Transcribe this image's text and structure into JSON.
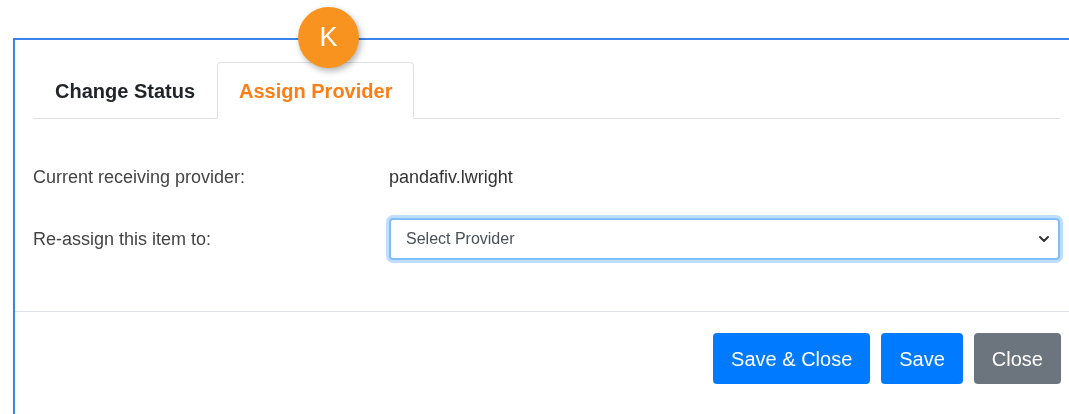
{
  "badge": {
    "label": "K"
  },
  "tabs": [
    {
      "label": "Change Status",
      "selected": false
    },
    {
      "label": "Assign Provider",
      "selected": true
    }
  ],
  "fields": [
    {
      "kind": "text",
      "label": "Current receiving provider:",
      "value": "pandafiv.lwright"
    },
    {
      "kind": "select",
      "label": "Re-assign this item to:",
      "value": "Select Provider"
    }
  ],
  "buttons": [
    {
      "label": "Save & Close",
      "kind": "primary"
    },
    {
      "label": "Save",
      "kind": "primary"
    },
    {
      "label": "Close",
      "kind": "secondary"
    }
  ]
}
